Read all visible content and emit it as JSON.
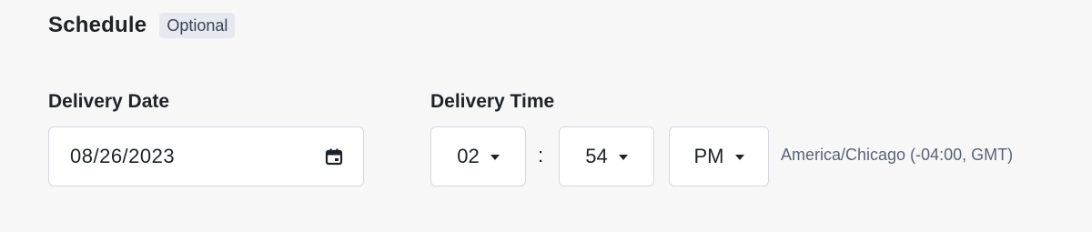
{
  "schedule": {
    "title": "Schedule",
    "badge": "Optional"
  },
  "delivery_date": {
    "label": "Delivery Date",
    "value": "08/26/2023",
    "icon": "calendar-icon"
  },
  "delivery_time": {
    "label": "Delivery Time",
    "hour": "02",
    "separator": ":",
    "minute": "54",
    "meridiem": "PM",
    "timezone": "America/Chicago (-04:00, GMT)"
  }
}
